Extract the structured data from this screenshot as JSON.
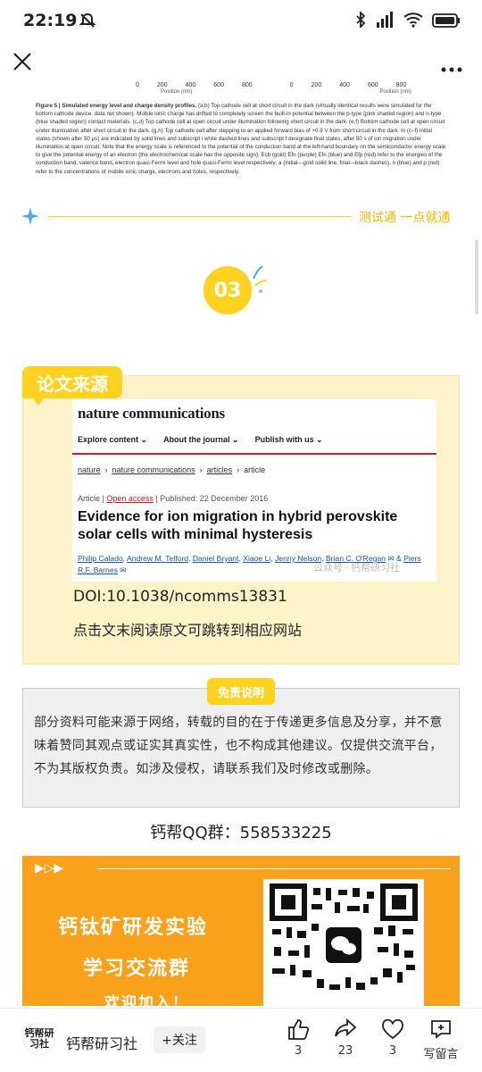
{
  "status_bar": {
    "time": "22:19"
  },
  "figure": {
    "ticks_left": [
      "0",
      "200",
      "400",
      "600",
      "800"
    ],
    "ticks_right": [
      "0",
      "200",
      "400",
      "600",
      "800"
    ],
    "axis_label": "Position (nm)",
    "caption_bold": "Figure 5 | Simulated energy level and charge density profiles.",
    "caption_text": "(a,b) Top cathode cell at short circuit in the dark (virtually identical results were simulated for the bottom cathode device, data not shown). Mobile ionic charge has drifted to completely screen the built-in potential between the p-type (pink shaded region) and n-type (blue shaded region) contact materials. (c,d) Top cathode cell at open circuit under illumination following short circuit in the dark. (e,f) Bottom cathode cell at open circuit under illumination after short circuit in the dark. (g,h) Top cathode cell after stepping to an applied forward bias of +0.9 V from short circuit in the dark. In (c–f) initial states (shown after 50 µs) are indicated by solid lines and subscript i while dashed lines and subscript f designate final states, after 50 s of ion migration under illumination at open circuit. Note that the energy scale is referenced to the potential of the conduction band at the left-hand boundary on the semiconductor energy scale to give the potential energy of an electron (the electrochemical scale has the opposite sign). Ecb (gold) Efn (purple) Efn (blue) and Efp (red) refer to the energies of the conduction band, valence band, electron quasi-Fermi level and hole quasi-Fermi level respectively; a (initial—gold solid line, final—black dashes), n (blue) and p (red) refer to the concentrations of mobile ionic charge, electrons and holes, respectively."
  },
  "divider": {
    "text": "测试通 一点就通"
  },
  "section_number": "03",
  "source": {
    "tag": "论文来源",
    "journal": "nature communications",
    "menu": [
      "Explore content ⌄",
      "About the journal ⌄",
      "Publish with us ⌄"
    ],
    "breadcrumbs": [
      "nature",
      "nature communications",
      "articles",
      "article"
    ],
    "meta_type": "Article",
    "meta_oa": "Open access",
    "meta_date": "Published: 22 December 2016",
    "title": "Evidence for ion migration in hybrid perovskite solar cells with minimal hysteresis",
    "authors": [
      "Philip Calado",
      "Andrew M. Telford",
      "Daniel Bryant",
      "Xiaoe Li",
      "Jenny Nelson",
      "Brian C. O'Regan",
      "Piers R.F. Barnes"
    ],
    "watermark": "公众号 · 钙帮研习社",
    "doi": "DOI:10.1038/ncomms13831",
    "jump_text": "点击文末阅读原文可跳转到相应网站"
  },
  "disclaimer": {
    "tag": "免责说明",
    "text": "部分资料可能来源于网络，转载的目的在于传递更多信息及分享，并不意味着赞同其观点或证实其真实性，也不构成其他建议。仅提供交流平台，不为其版权负责。如涉及侵权，请联系我们及时修改或删除。"
  },
  "qq_group": "钙帮QQ群：558533225",
  "banner": {
    "line1": "钙钛矿研发实验",
    "line2": "学习交流群",
    "line3": "欢迎加入！"
  },
  "bottom_bar": {
    "logo_text": "钙帮研习社",
    "account": "钙帮研习社",
    "follow": "+关注",
    "like_count": "3",
    "share_count": "23",
    "fav_count": "3",
    "comment_label": "写留言"
  }
}
